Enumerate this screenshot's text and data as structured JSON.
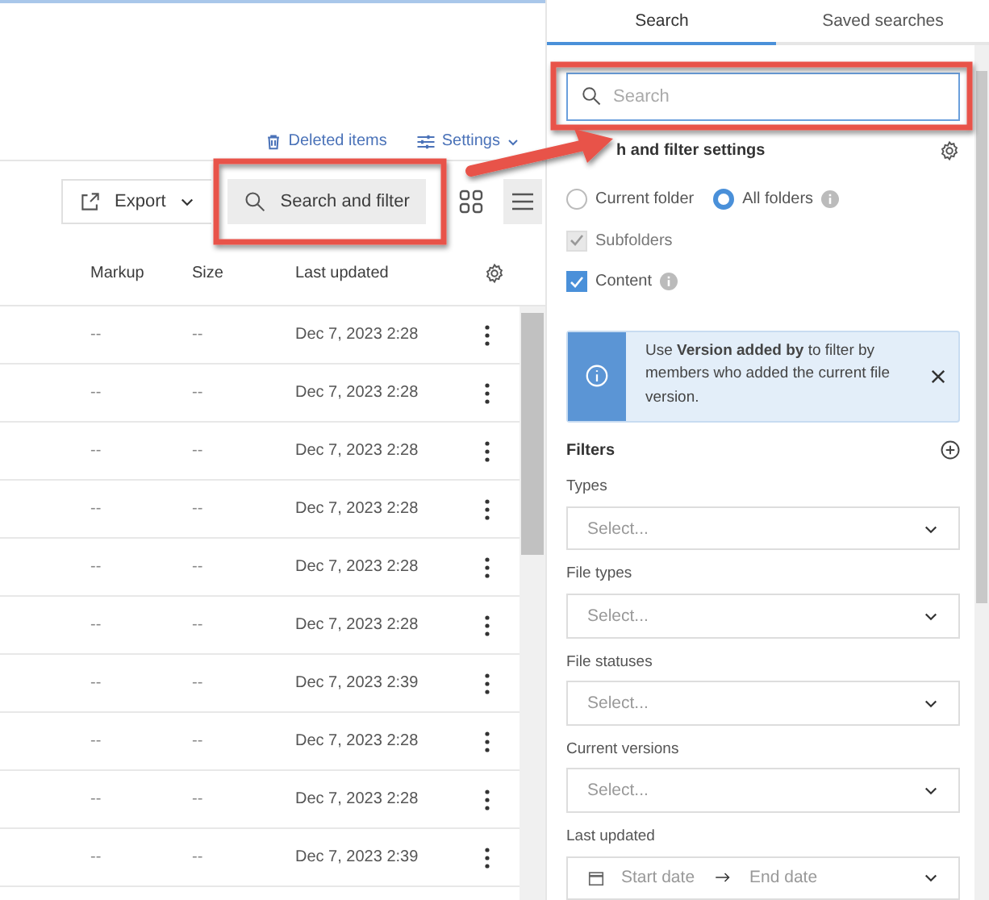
{
  "header_links": [
    {
      "label": "Deleted items",
      "kind": "trash"
    },
    {
      "label": "Settings",
      "kind": "sliders"
    }
  ],
  "toolbar": {
    "export": "Export",
    "search_button": "Search and filter",
    "views": [
      {
        "kind": "grid",
        "selected": false
      },
      {
        "kind": "list",
        "selected": true
      }
    ]
  },
  "table": {
    "columns": [
      "Markup",
      "Size",
      "Last updated"
    ],
    "rows": [
      {
        "markup": "--",
        "size": "--",
        "updated": "Dec 7, 2023 2:28"
      },
      {
        "markup": "--",
        "size": "--",
        "updated": "Dec 7, 2023 2:28"
      },
      {
        "markup": "--",
        "size": "--",
        "updated": "Dec 7, 2023 2:28"
      },
      {
        "markup": "--",
        "size": "--",
        "updated": "Dec 7, 2023 2:28"
      },
      {
        "markup": "--",
        "size": "--",
        "updated": "Dec 7, 2023 2:28"
      },
      {
        "markup": "--",
        "size": "--",
        "updated": "Dec 7, 2023 2:28"
      },
      {
        "markup": "--",
        "size": "--",
        "updated": "Dec 7, 2023 2:39"
      },
      {
        "markup": "--",
        "size": "--",
        "updated": "Dec 7, 2023 2:28"
      },
      {
        "markup": "--",
        "size": "--",
        "updated": "Dec 7, 2023 2:28"
      },
      {
        "markup": "--",
        "size": "--",
        "updated": "Dec 7, 2023 2:39"
      }
    ]
  },
  "panel": {
    "tabs": [
      {
        "label": "Search",
        "selected": true
      },
      {
        "label": "Saved searches",
        "selected": false
      }
    ],
    "search": {
      "placeholder": "Search"
    },
    "settings_title": "h and filter settings",
    "scope": [
      {
        "label": "Current folder",
        "selected": false,
        "info": false
      },
      {
        "label": "All folders",
        "selected": true,
        "info": true
      }
    ],
    "options": [
      {
        "label": "Subfolders",
        "checked": true,
        "disabled": true,
        "info": false
      },
      {
        "label": "Content",
        "checked": true,
        "disabled": false,
        "info": true
      }
    ],
    "banner": {
      "text": "Use **Version added by** to filter by members who added the current file version."
    },
    "filters_title": "Filters",
    "filters": [
      {
        "label": "Types",
        "kind": "select",
        "placeholder": "Select..."
      },
      {
        "label": "File types",
        "kind": "select",
        "placeholder": "Select..."
      },
      {
        "label": "File statuses",
        "kind": "select",
        "placeholder": "Select..."
      },
      {
        "label": "Current versions",
        "kind": "select",
        "placeholder": "Select..."
      },
      {
        "label": "Last updated",
        "kind": "date_range",
        "start": "Start date",
        "end": "End date"
      }
    ]
  }
}
